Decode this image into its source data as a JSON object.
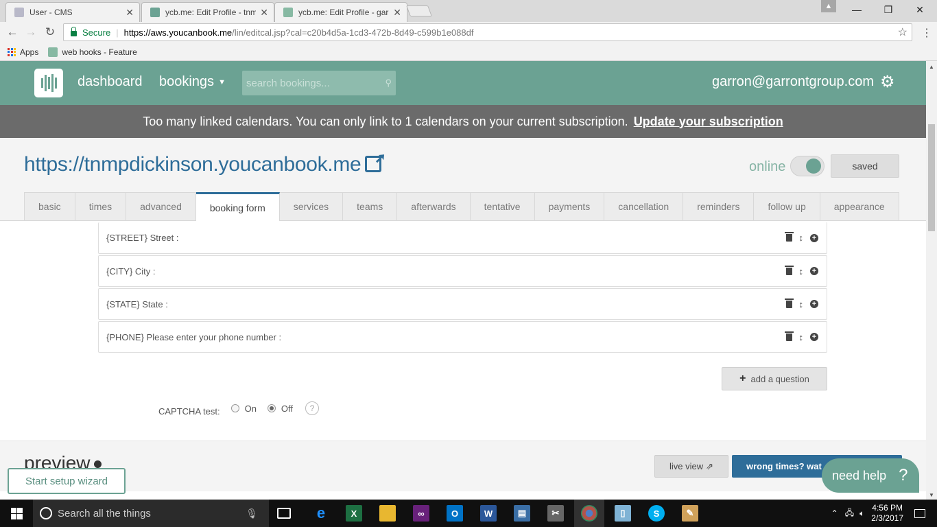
{
  "browser": {
    "tabs": [
      {
        "title": "User - CMS",
        "active": false
      },
      {
        "title": "ycb.me: Edit Profile - tnm",
        "active": true
      },
      {
        "title": "ycb.me: Edit Profile - gar",
        "active": false
      }
    ],
    "secure_label": "Secure",
    "url_scheme_host": "https://aws.youcanbook.me",
    "url_path": "/lin/editcal.jsp?cal=c20b4d5a-1cd3-472b-8d49-c599b1e088df",
    "bookmarks": [
      {
        "label": "Apps"
      },
      {
        "label": "web hooks - Feature"
      }
    ]
  },
  "header": {
    "nav_dashboard": "dashboard",
    "nav_bookings": "bookings",
    "search_placeholder": "search bookings...",
    "user_email": "garron@garrontgroup.com"
  },
  "warning": {
    "message": "Too many linked calendars. You can only link to 1 calendars on your current subscription.",
    "link": "Update your subscription"
  },
  "profile": {
    "url": "https://tnmpdickinson.youcanbook.me",
    "online_label": "online",
    "online": true,
    "saved_label": "saved",
    "tabs": [
      "basic",
      "times",
      "advanced",
      "booking form",
      "services",
      "teams",
      "afterwards",
      "tentative",
      "payments",
      "cancellation",
      "reminders",
      "follow up",
      "appearance"
    ],
    "active_tab": "booking form"
  },
  "questions": [
    "{STREET} Street :",
    "{CITY} City :",
    "{STATE} State :",
    "{PHONE} Please enter your phone number :"
  ],
  "add_question_label": "add a question",
  "captcha": {
    "label": "CAPTCHA test:",
    "on_label": "On",
    "off_label": "Off",
    "selected": "Off"
  },
  "preview": {
    "title": "preview",
    "live_view_label": "live view",
    "wrong_times_label": "wrong times? wat"
  },
  "widgets": {
    "setup_wizard_label": "Start setup wizard",
    "need_help_label": "need help",
    "need_help_q": "?"
  },
  "taskbar": {
    "search_placeholder": "Search all the things",
    "time": "4:56 PM",
    "date": "2/3/2017"
  },
  "colors": {
    "brand_green": "#6ba293",
    "link_blue": "#2e6d99",
    "warning_gray": "#6b6b6b"
  }
}
